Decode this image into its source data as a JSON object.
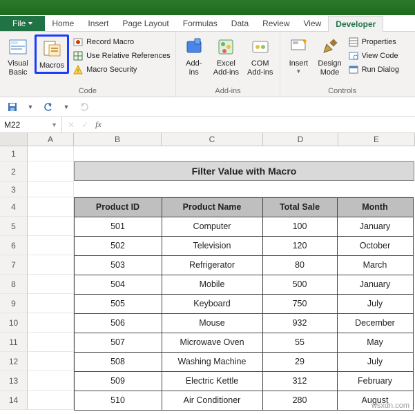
{
  "tabs": {
    "file": "File",
    "home": "Home",
    "insert": "Insert",
    "page_layout": "Page Layout",
    "formulas": "Formulas",
    "data": "Data",
    "review": "Review",
    "view": "View",
    "developer": "Developer"
  },
  "ribbon": {
    "code_group": {
      "visual_basic": "Visual\nBasic",
      "macros": "Macros",
      "record_macro": "Record Macro",
      "use_rel": "Use Relative References",
      "macro_security": "Macro Security",
      "label": "Code"
    },
    "addins_group": {
      "addins": "Add-\nins",
      "excel_addins": "Excel\nAdd-ins",
      "com_addins": "COM\nAdd-ins",
      "label": "Add-ins"
    },
    "controls_group": {
      "insert": "Insert",
      "design_mode": "Design\nMode",
      "properties": "Properties",
      "view_code": "View Code",
      "run_dialog": "Run Dialog",
      "label": "Controls"
    }
  },
  "namebox": "M22",
  "columns": [
    "A",
    "B",
    "C",
    "D",
    "E"
  ],
  "title": "Filter Value with Macro",
  "headers": {
    "b": "Product ID",
    "c": "Product Name",
    "d": "Total Sale",
    "e": "Month"
  },
  "rows": [
    {
      "n": 5,
      "b": "501",
      "c": "Computer",
      "d": "100",
      "e": "January"
    },
    {
      "n": 6,
      "b": "502",
      "c": "Television",
      "d": "120",
      "e": "October"
    },
    {
      "n": 7,
      "b": "503",
      "c": "Refrigerator",
      "d": "80",
      "e": "March"
    },
    {
      "n": 8,
      "b": "504",
      "c": "Mobile",
      "d": "500",
      "e": "January"
    },
    {
      "n": 9,
      "b": "505",
      "c": "Keyboard",
      "d": "750",
      "e": "July"
    },
    {
      "n": 10,
      "b": "506",
      "c": "Mouse",
      "d": "932",
      "e": "December"
    },
    {
      "n": 11,
      "b": "507",
      "c": "Microwave Oven",
      "d": "55",
      "e": "May"
    },
    {
      "n": 12,
      "b": "508",
      "c": "Washing Machine",
      "d": "29",
      "e": "July"
    },
    {
      "n": 13,
      "b": "509",
      "c": "Electric Kettle",
      "d": "312",
      "e": "February"
    },
    {
      "n": 14,
      "b": "510",
      "c": "Air Conditioner",
      "d": "280",
      "e": "August"
    }
  ],
  "watermark": "wsxdn.com"
}
